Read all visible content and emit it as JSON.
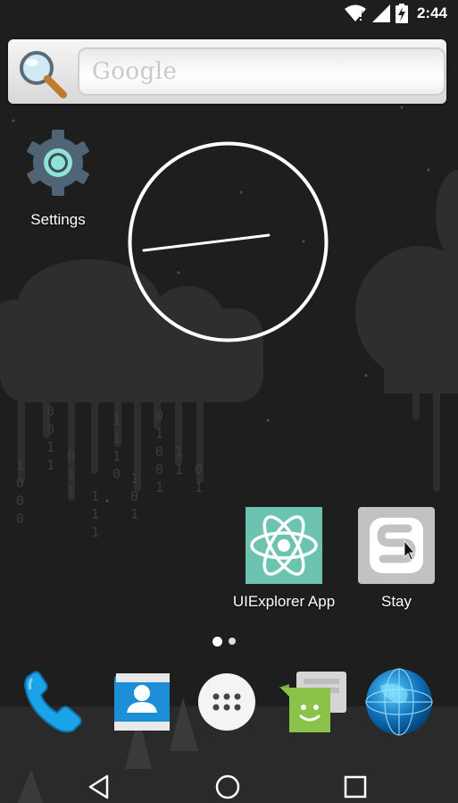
{
  "status_bar": {
    "time": "2:44",
    "icons": [
      "wifi-icon",
      "signal-icon",
      "battery-charging-icon"
    ]
  },
  "search_widget": {
    "placeholder": "Google",
    "icon": "magnifier-icon"
  },
  "desktop": {
    "apps": [
      {
        "id": "settings",
        "label": "Settings",
        "icon": "gear-icon"
      },
      {
        "id": "uiexplorer",
        "label": "UIExplorer App",
        "icon": "react-atom-icon"
      },
      {
        "id": "stay",
        "label": "Stay",
        "icon": "stay-s-icon"
      }
    ],
    "clock_widget": {
      "type": "analog"
    }
  },
  "page_indicator": {
    "pages": 2,
    "current": 1
  },
  "dock": {
    "items": [
      "phone-icon",
      "contacts-icon",
      "app-drawer-icon",
      "messenger-icon",
      "browser-globe-icon"
    ]
  },
  "nav_bar": {
    "buttons": [
      "back-icon",
      "home-icon",
      "recents-icon"
    ]
  },
  "colors": {
    "background": "#1e1e1e",
    "cloud": "#2e2e2e",
    "react_tile": "#6cc4b0",
    "stay_tile": "#c2c2c2",
    "phone_blue": "#1aa3e8",
    "messenger_green": "#8bc34a"
  }
}
